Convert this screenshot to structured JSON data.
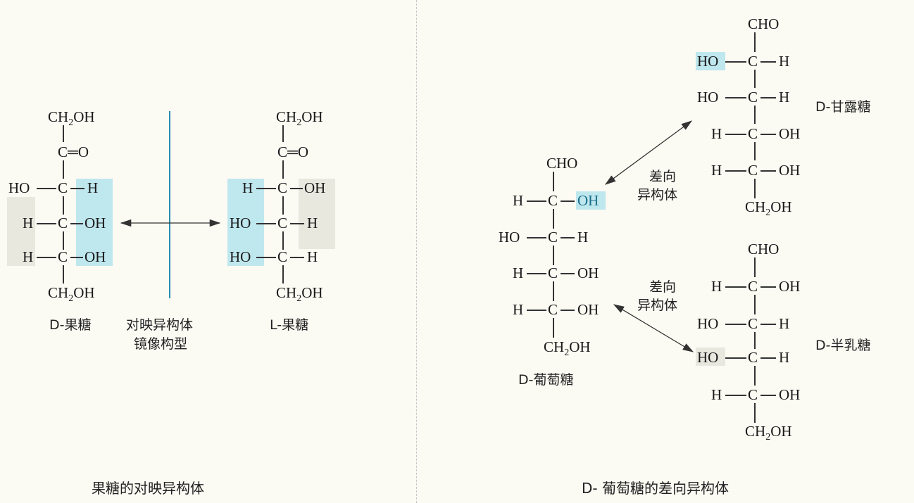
{
  "fructose": {
    "d_label": "D-果糖",
    "l_label": "L-果糖",
    "mirror_label_line1": "对映异构体",
    "mirror_label_line2": "镜像构型",
    "caption": "果糖的对映异构体",
    "ch2oh": "CH",
    "ch2oh_sub": "2",
    "ch2oh_end": "OH",
    "co": "C═O",
    "ho": "HO",
    "oh": "OH",
    "h": "H",
    "c": "C"
  },
  "glucose": {
    "d_glucose_label": "D-葡萄糖",
    "mannose_label": "D-甘露糖",
    "galactose_label": "D-半乳糖",
    "epimer_label_line1": "差向",
    "epimer_label_line2": "异构体",
    "caption": "D- 葡萄糖的差向异构体",
    "cho": "CHO"
  },
  "colors": {
    "highlight": "#bfe7ee",
    "shade": "#e8e8df",
    "mirror_line": "#2a8fb0",
    "divider": "#c8c8c8"
  }
}
